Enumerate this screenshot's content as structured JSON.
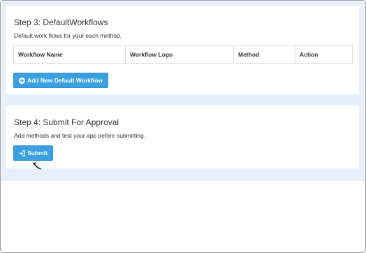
{
  "step3": {
    "title": "Step 3: DefaultWorkflows",
    "description": "Default work flows for your each method.",
    "table_headers": [
      "Workflow Name",
      "Workflow Logo",
      "Method",
      "Action"
    ],
    "add_button_label": "Add New Default Workflow",
    "add_button_icon": "plus-circle-icon"
  },
  "step4": {
    "title": "Step 4: Submit For Approval",
    "description": "Add methods and test your app before submitting.",
    "submit_button_label": "Submit",
    "submit_button_icon": "sign-in-icon"
  },
  "colors": {
    "page_background": "#e7f0fa",
    "button_blue": "#3aa0e0"
  }
}
